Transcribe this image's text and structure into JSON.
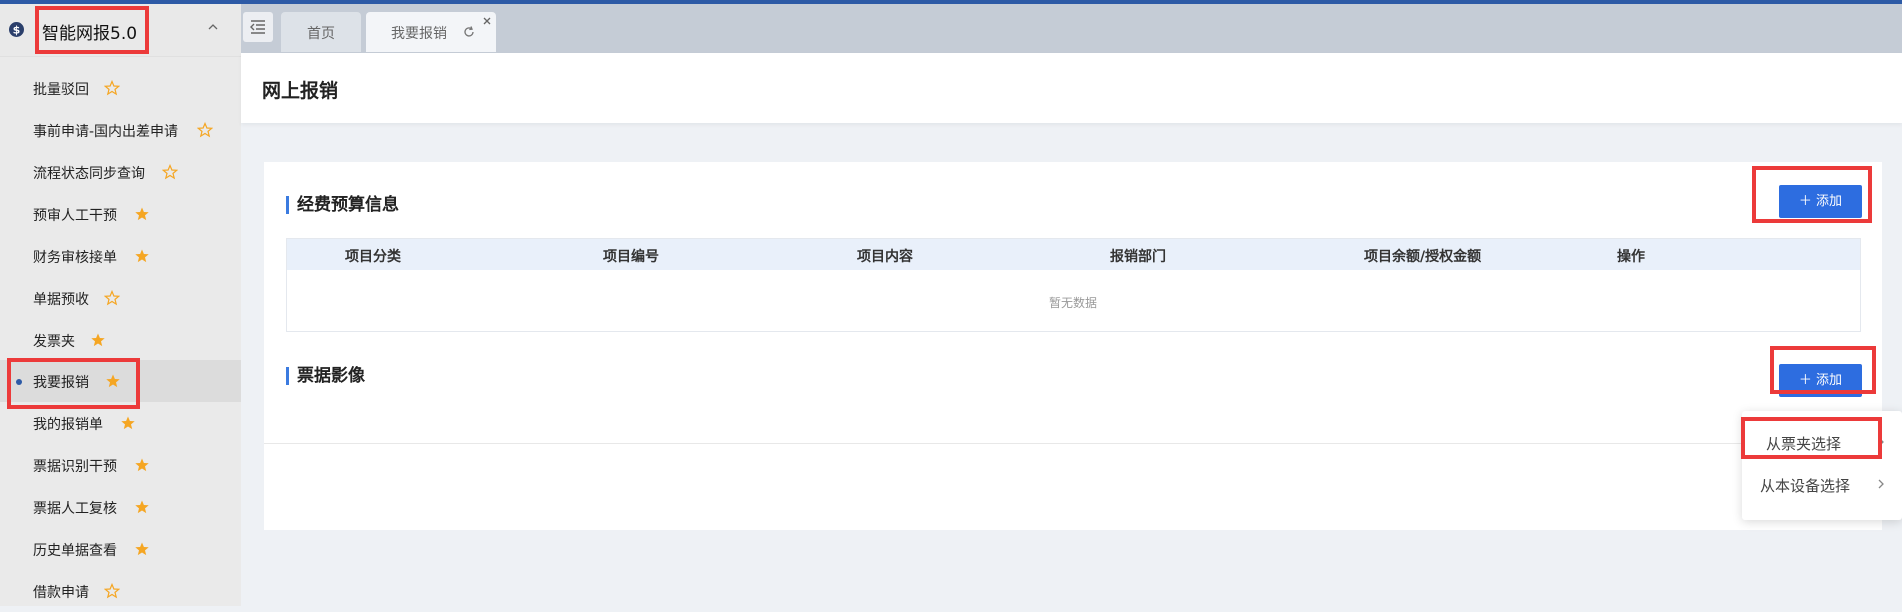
{
  "app": {
    "title": "智能网报5.0"
  },
  "sidebar": {
    "items": [
      {
        "label": "批量驳回",
        "starred": false
      },
      {
        "label": "事前申请-国内出差申请",
        "starred": false
      },
      {
        "label": "流程状态同步查询",
        "starred": false
      },
      {
        "label": "预审人工干预",
        "starred": true
      },
      {
        "label": "财务审核接单",
        "starred": true
      },
      {
        "label": "单据预收",
        "starred": false
      },
      {
        "label": "发票夹",
        "starred": true
      },
      {
        "label": "我要报销",
        "starred": true,
        "active": true
      },
      {
        "label": "我的报销单",
        "starred": true
      },
      {
        "label": "票据识别干预",
        "starred": true
      },
      {
        "label": "票据人工复核",
        "starred": true
      },
      {
        "label": "历史单据查看",
        "starred": true
      },
      {
        "label": "借款申请",
        "starred": false
      }
    ]
  },
  "tabs": [
    {
      "label": "首页"
    },
    {
      "label": "我要报销"
    }
  ],
  "page": {
    "title": "网上报销"
  },
  "budget": {
    "title": "经费预算信息",
    "add_label": "＋ 添加",
    "columns": [
      "项目分类",
      "项目编号",
      "项目内容",
      "报销部门",
      "项目余额/授权金额",
      "操作"
    ],
    "empty_text": "暂无数据"
  },
  "invoice": {
    "title": "票据影像",
    "add_label": "＋ 添加"
  },
  "dropdown": {
    "items": [
      {
        "label": "从票夹选择"
      },
      {
        "label": "从本设备选择"
      }
    ]
  },
  "colors": {
    "accent": "#2d6de0",
    "star": "#f5a623",
    "highlight": "#ec3a3a",
    "topbar": "#2d5aa6"
  },
  "icons": {
    "logo": "money-icon",
    "sidebar_toggle": "chevron-up-icon",
    "collapse": "collapse-menu-icon",
    "tab_refresh": "refresh-icon",
    "tab_close": "close-icon",
    "star": "star-icon",
    "dropdown_chevron": "chevron-right-icon"
  }
}
